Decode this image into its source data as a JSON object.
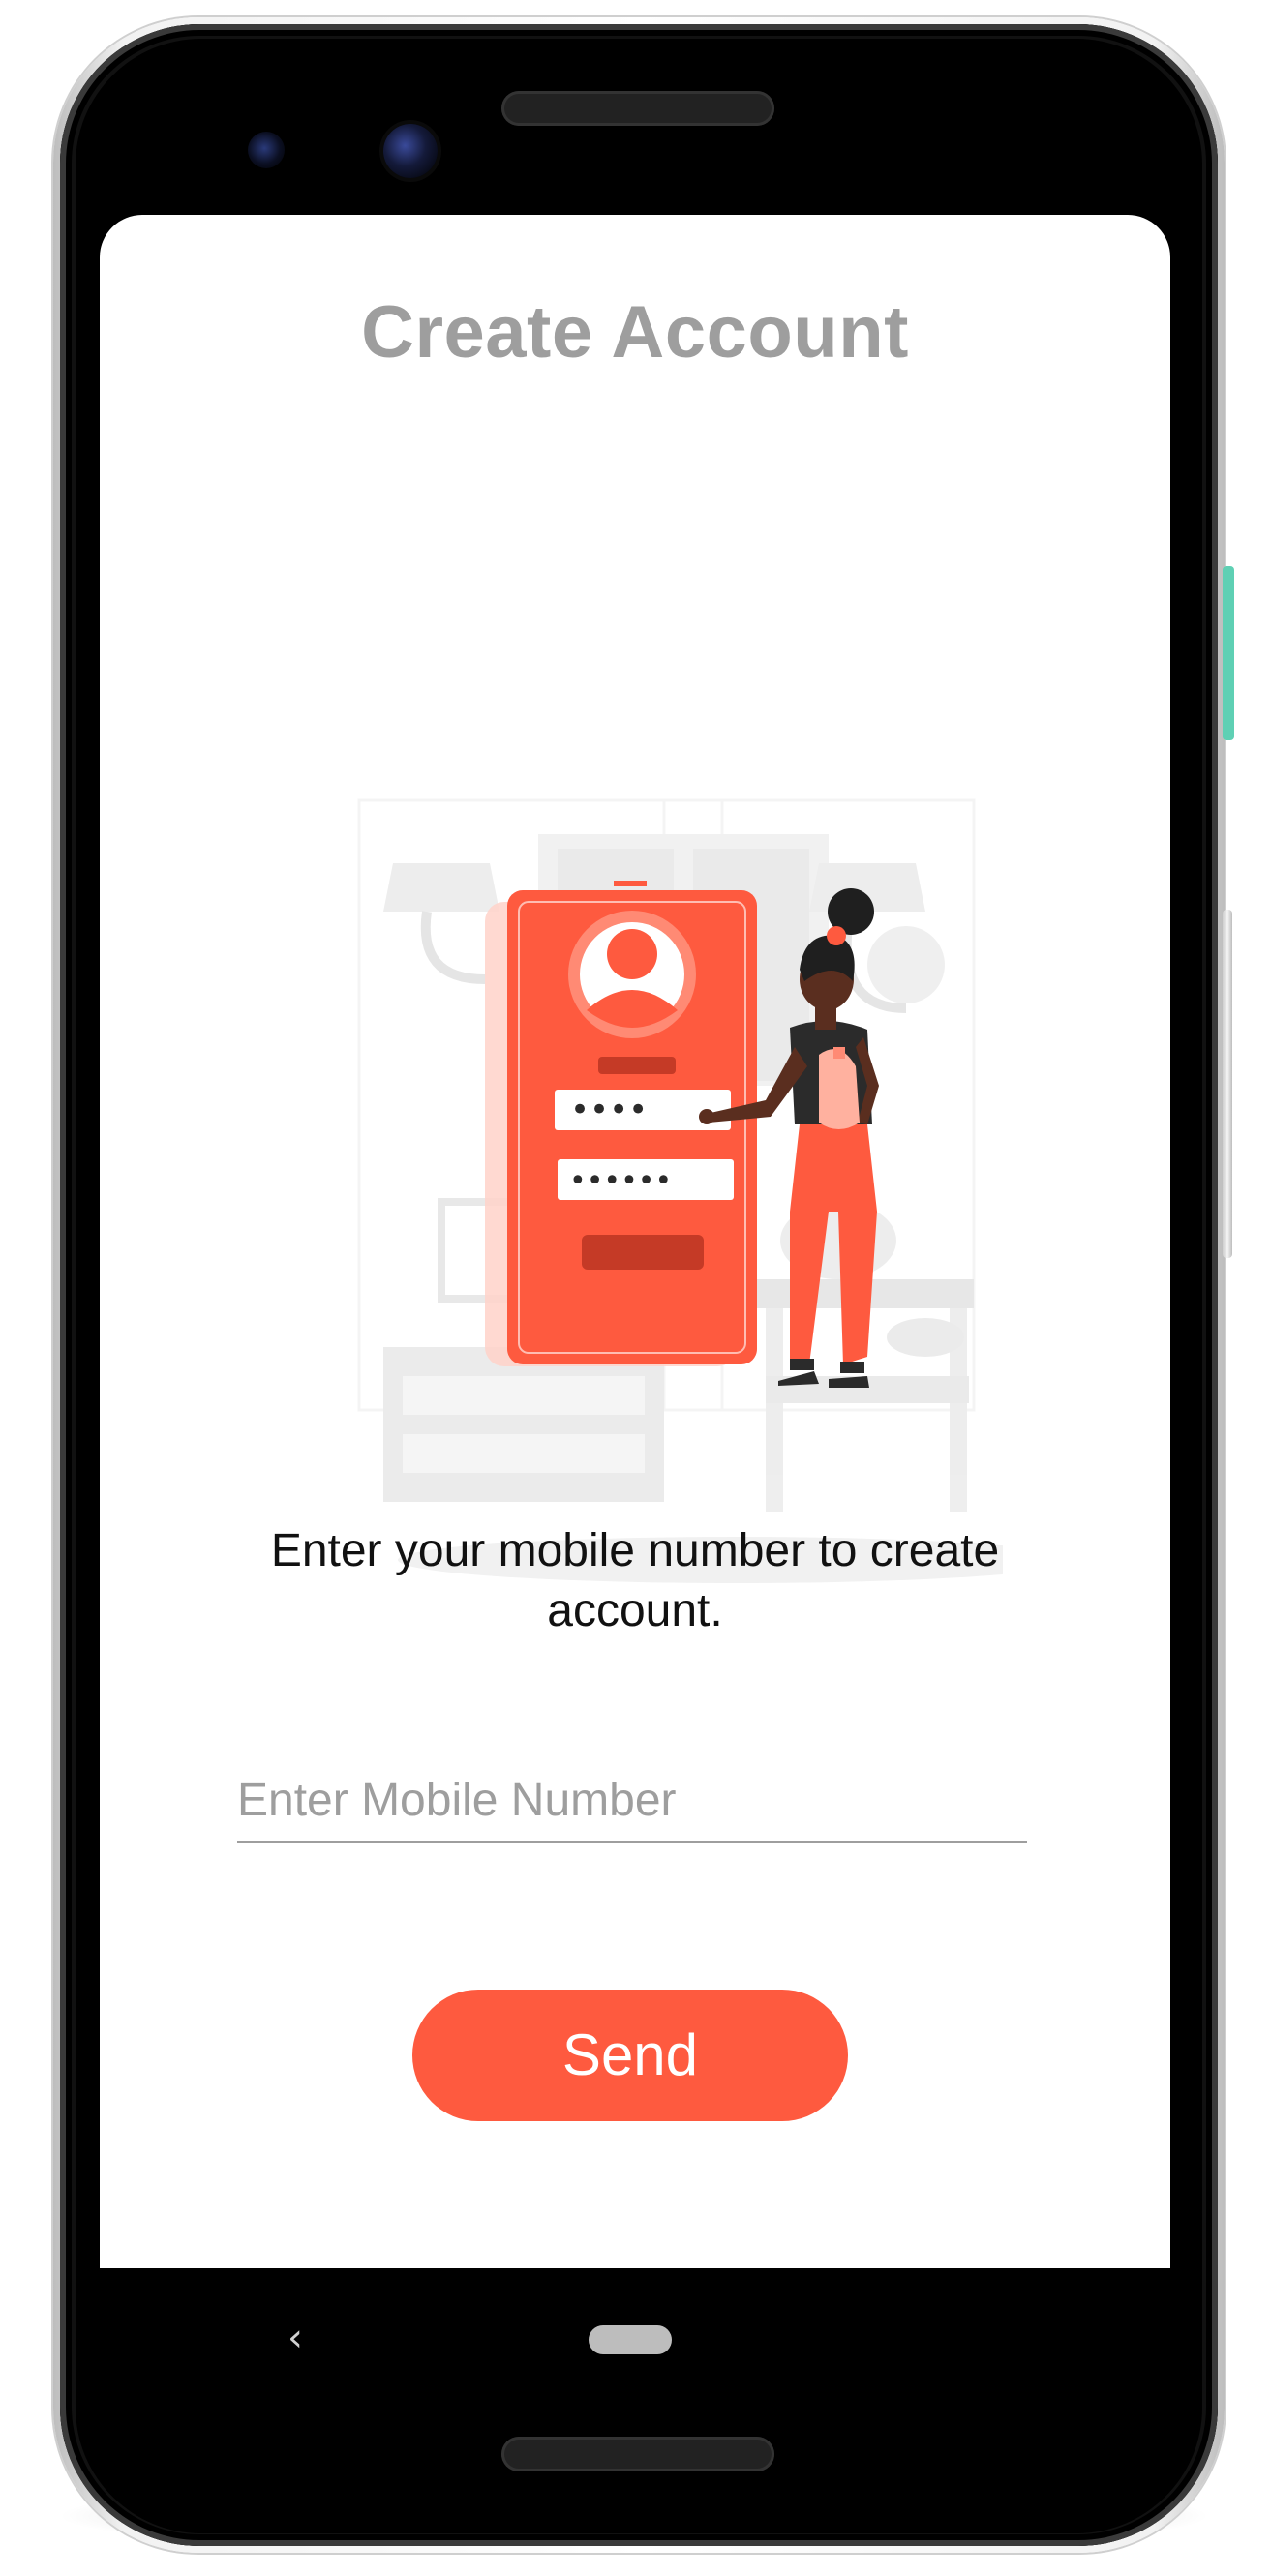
{
  "screen": {
    "title": "Create Account",
    "subtitle": "Enter your mobile number to create account.",
    "mobile_input": {
      "value": "",
      "placeholder": "Enter Mobile Number"
    },
    "send_button": {
      "label": "Send"
    }
  },
  "illustration": {
    "pin_dots": "••••",
    "password_dots": "••••••"
  },
  "nav_bar": {
    "back_glyph": "‹"
  },
  "colors": {
    "accent": "#fe5a3f",
    "title": "#9e9e9e",
    "underline": "#9e9e9e",
    "background": "#ffffff",
    "bezel": "#000000"
  },
  "icons": [
    "back-icon",
    "home-pill-icon",
    "user-avatar-icon"
  ]
}
